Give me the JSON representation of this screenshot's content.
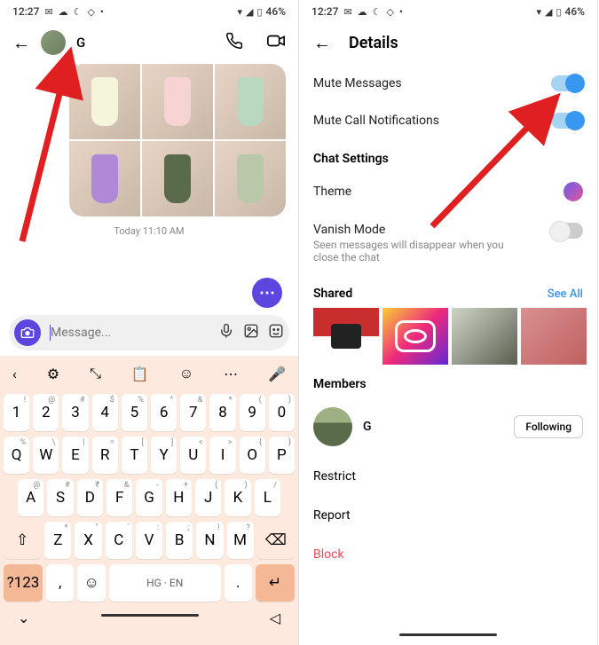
{
  "status": {
    "time": "12:27",
    "battery": "46%"
  },
  "status_icons": {
    "i1": "✉",
    "i2": "☁",
    "i3": "☾",
    "i4": "◇",
    "dot": "•",
    "wifi": "▾",
    "sig": "◢",
    "bat": "▯"
  },
  "chat": {
    "name": "G",
    "sub": "",
    "timestamp": "Today 11:10 AM",
    "placeholder": "Message...",
    "options_label": "⋯"
  },
  "icons": {
    "back": "←",
    "call": "📞",
    "video": "▢",
    "camera": "◉",
    "mic": "🎤",
    "gallery": "🖼",
    "sticker": "☺",
    "kb_chev": "‹",
    "kb_gear": "⚙",
    "kb_move": "⤡",
    "kb_clip": "📋",
    "kb_sticker": "☺",
    "kb_more": "⋯",
    "kb_mic": "🎤",
    "shift": "⇧",
    "backspace": "⌫",
    "comma": ",",
    "emoji": "☺",
    "period": ".",
    "enter": "↵",
    "nav_down": "⌄",
    "nav_sq": "▢",
    "nav_back": "◁"
  },
  "keys": {
    "numbers": [
      "1",
      "2",
      "3",
      "4",
      "5",
      "6",
      "7",
      "8",
      "9",
      "0"
    ],
    "num_sup": [
      "!",
      "@",
      "#",
      "$",
      "%",
      "^",
      "&",
      "*",
      "(",
      ")"
    ],
    "row1": [
      "Q",
      "W",
      "E",
      "R",
      "T",
      "Y",
      "U",
      "I",
      "O",
      "P"
    ],
    "row1_sup": [
      "%",
      "\\",
      "|",
      "=",
      "[",
      "]",
      "<",
      ">",
      "{",
      "}"
    ],
    "row2": [
      "A",
      "S",
      "D",
      "F",
      "G",
      "H",
      "J",
      "K",
      "L"
    ],
    "row2_sup": [
      "@",
      "#",
      "₹",
      "&",
      "-",
      "+",
      "(",
      ")",
      "/"
    ],
    "row3": [
      "Z",
      "X",
      "C",
      "V",
      "B",
      "N",
      "M"
    ],
    "row3_sup": [
      "*",
      "\"",
      "'",
      ":",
      ";",
      "!",
      "?"
    ],
    "sym_key": "?123",
    "space_label": "HG · EN"
  },
  "details": {
    "title": "Details",
    "mute_msg": "Mute Messages",
    "mute_call": "Mute Call Notifications",
    "chat_settings": "Chat Settings",
    "theme": "Theme",
    "vanish": "Vanish Mode",
    "vanish_sub": "Seen messages will disappear when you close the chat",
    "shared": "Shared",
    "see_all": "See All",
    "members": "Members",
    "member_name": "G",
    "following": "Following",
    "restrict": "Restrict",
    "report": "Report",
    "block": "Block"
  }
}
